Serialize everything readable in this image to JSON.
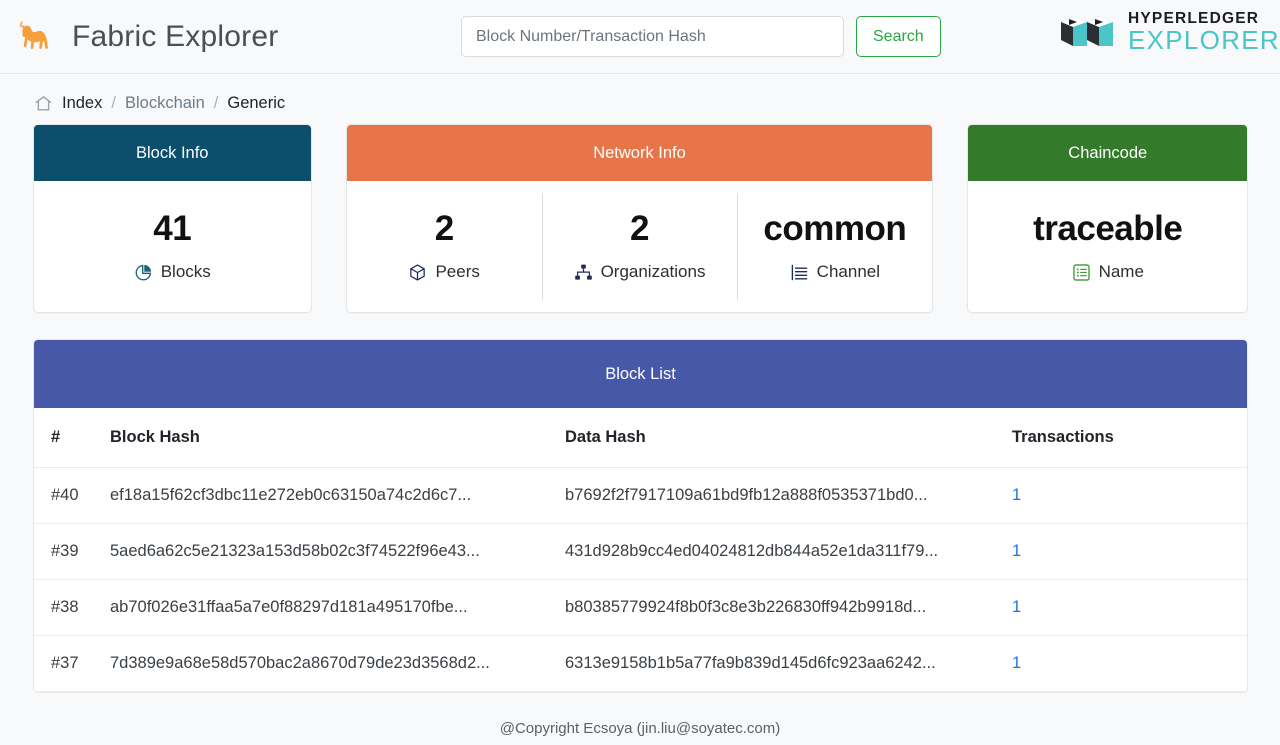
{
  "header": {
    "logo_icon": "camel-icon",
    "brand_title": "Fabric Explorer",
    "search": {
      "placeholder": "Block Number/Transaction Hash",
      "value": "",
      "button_label": "Search"
    },
    "hyperledger_logo": {
      "top_text": "HYPERLEDGER",
      "bottom_text": "EXPLORER",
      "icon": "hyperledger-blocks-icon"
    }
  },
  "breadcrumb": {
    "home_icon": "home-icon",
    "items": [
      {
        "label": "Index",
        "current": false
      },
      {
        "label": "Blockchain",
        "current": false
      },
      {
        "label": "Generic",
        "current": true
      }
    ],
    "separator": "/"
  },
  "cards": {
    "block_info": {
      "title": "Block Info",
      "header_color": "#0b4f6c",
      "stats": [
        {
          "value": "41",
          "label": "Blocks",
          "icon": "pie-chart-icon",
          "icon_color": "#17657f"
        }
      ]
    },
    "network_info": {
      "title": "Network Info",
      "header_color": "#e8744a",
      "stats": [
        {
          "value": "2",
          "label": "Peers",
          "icon": "cube-icon",
          "icon_color": "#1f2d5a"
        },
        {
          "value": "2",
          "label": "Organizations",
          "icon": "sitemap-icon",
          "icon_color": "#1f2d5a"
        },
        {
          "value": "common",
          "label": "Channel",
          "icon": "list-lines-icon",
          "icon_color": "#1f2d5a"
        }
      ]
    },
    "chaincode": {
      "title": "Chaincode",
      "header_color": "#347a2b",
      "stats": [
        {
          "value": "traceable",
          "label": "Name",
          "icon": "list-box-icon",
          "icon_color": "#4b9f43"
        }
      ]
    }
  },
  "block_list": {
    "title": "Block List",
    "header_color": "#4758a8",
    "columns": [
      "#",
      "Block Hash",
      "Data Hash",
      "Transactions"
    ],
    "rows": [
      {
        "number": "#40",
        "block_hash": "ef18a15f62cf3dbc11e272eb0c63150a74c2d6c7...",
        "data_hash": "b7692f2f7917109a61bd9fb12a888f0535371bd0...",
        "transactions": "1"
      },
      {
        "number": "#39",
        "block_hash": "5aed6a62c5e21323a153d58b02c3f74522f96e43...",
        "data_hash": "431d928b9cc4ed04024812db844a52e1da311f79...",
        "transactions": "1"
      },
      {
        "number": "#38",
        "block_hash": "ab70f026e31ffaa5a7e0f88297d181a495170fbe...",
        "data_hash": "b80385779924f8b0f3c8e3b226830ff942b9918d...",
        "transactions": "1"
      },
      {
        "number": "#37",
        "block_hash": "7d389e9a68e58d570bac2a8670d79de23d3568d2...",
        "data_hash": "6313e9158b1b5a77fa9b839d145d6fc923aa6242...",
        "transactions": "1"
      }
    ]
  },
  "footer": {
    "text": "@Copyright Ecsoya (jin.liu@soyatec.com)"
  }
}
